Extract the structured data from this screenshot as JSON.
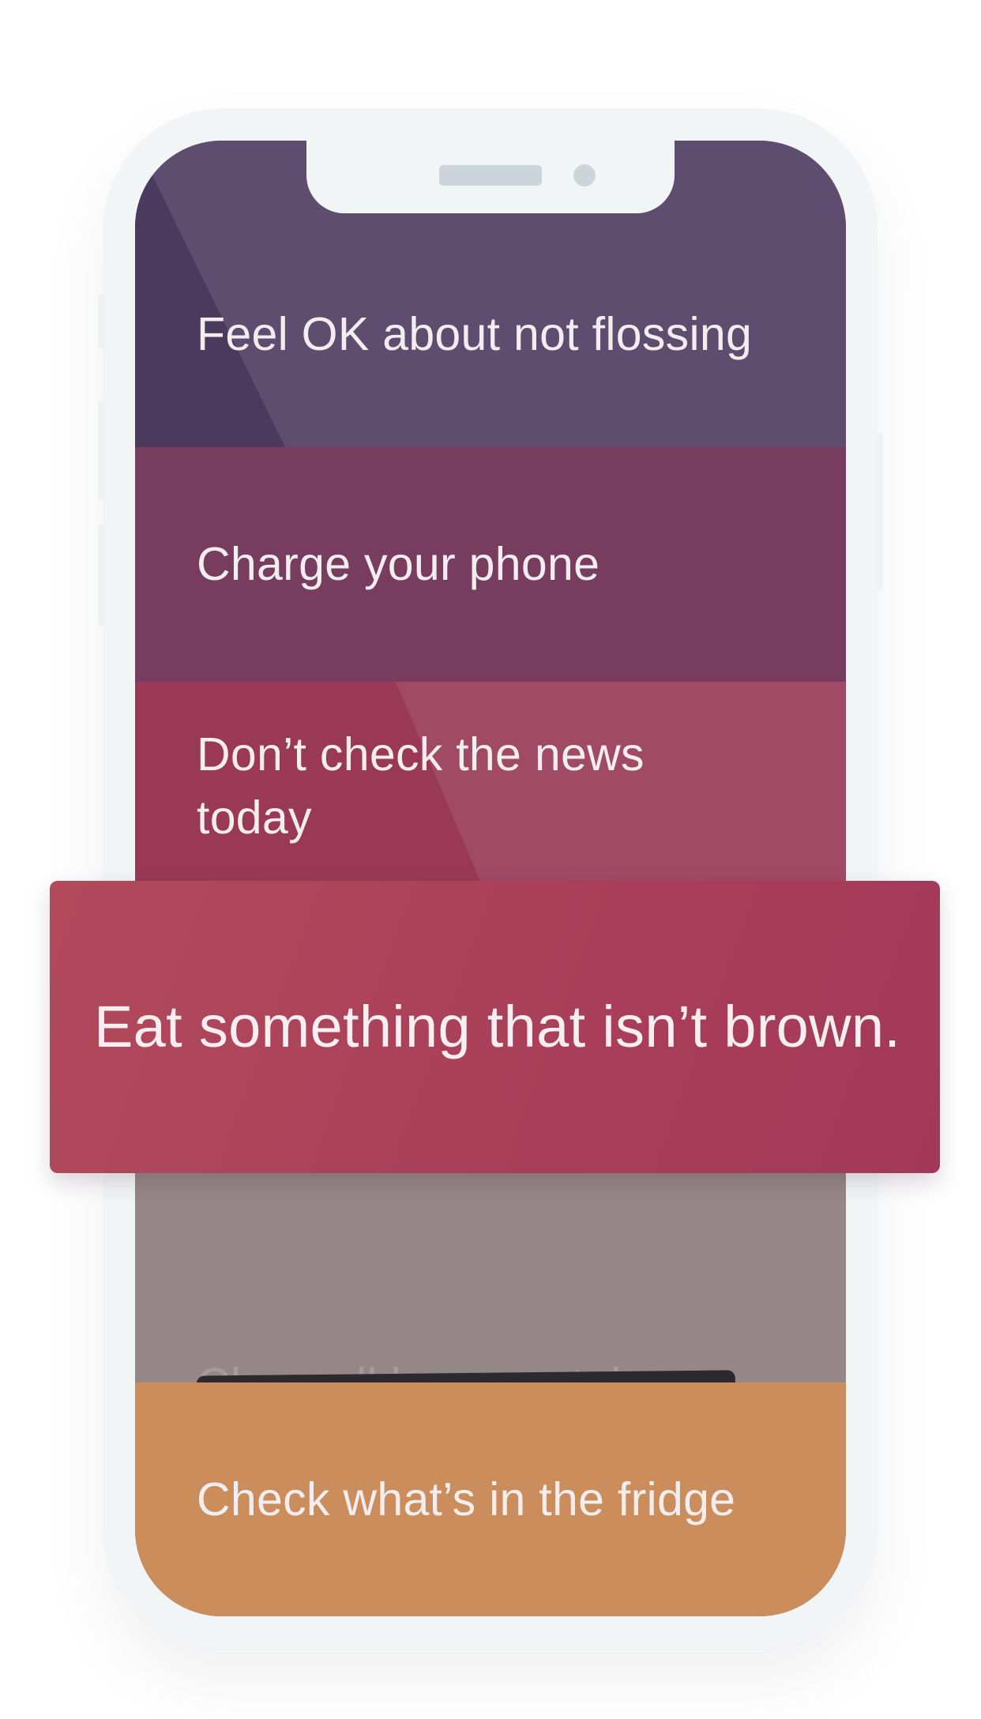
{
  "tasks": [
    {
      "label": "Feel OK about not flossing",
      "color": "#5f4d70"
    },
    {
      "label": "Charge your phone",
      "color": "#773c5e"
    },
    {
      "label": "Don’t check the news today",
      "color": "#a14a65"
    },
    {
      "label": "Close all browser tabs",
      "color": "#958687",
      "state": "crossed-out"
    },
    {
      "label": "Check what’s in the fridge",
      "color": "#cc8d5d"
    }
  ],
  "featured_card": {
    "label": "Eat something that isn’t brown.",
    "color": "#ab405a"
  }
}
